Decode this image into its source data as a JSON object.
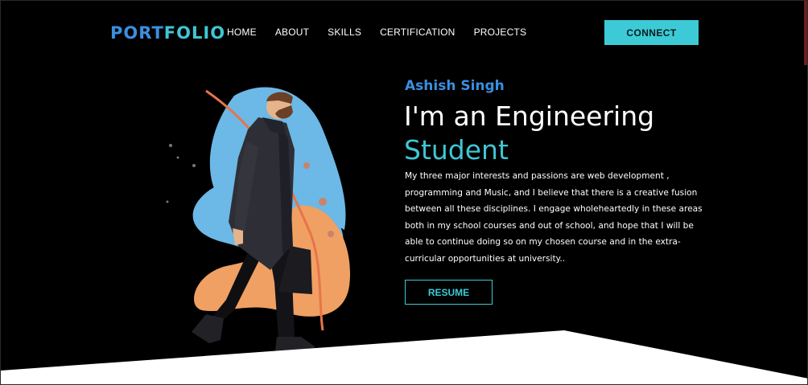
{
  "nav": {
    "logo_part1": "PORT",
    "logo_part2": "FOLIO",
    "links": [
      "HOME",
      "ABOUT",
      "SKILLS",
      "CERTIFICATION",
      "PROJECTS"
    ],
    "connect_label": "CONNECT"
  },
  "hero": {
    "name": "Ashish Singh",
    "headline_line1": "I'm an Engineering",
    "headline_line2": "Student",
    "bio_lines": [
      "My three major interests and passions are web development ,",
      "programming and Music, and I believe that there is a creative fusion",
      "between all these disciplines. I engage wholeheartedly in these areas",
      "both in my school courses and out of school, and hope that I will be",
      "able to continue doing so on my chosen course and in the extra-",
      "curricular opportunities at university.."
    ],
    "resume_label": "RESUME"
  },
  "colors": {
    "background": "#000000",
    "accent_blue": "#3a8fe0",
    "accent_cyan": "#3ccbd6",
    "blob_blue": "#6cb8e6",
    "blob_orange": "#f0a063"
  }
}
